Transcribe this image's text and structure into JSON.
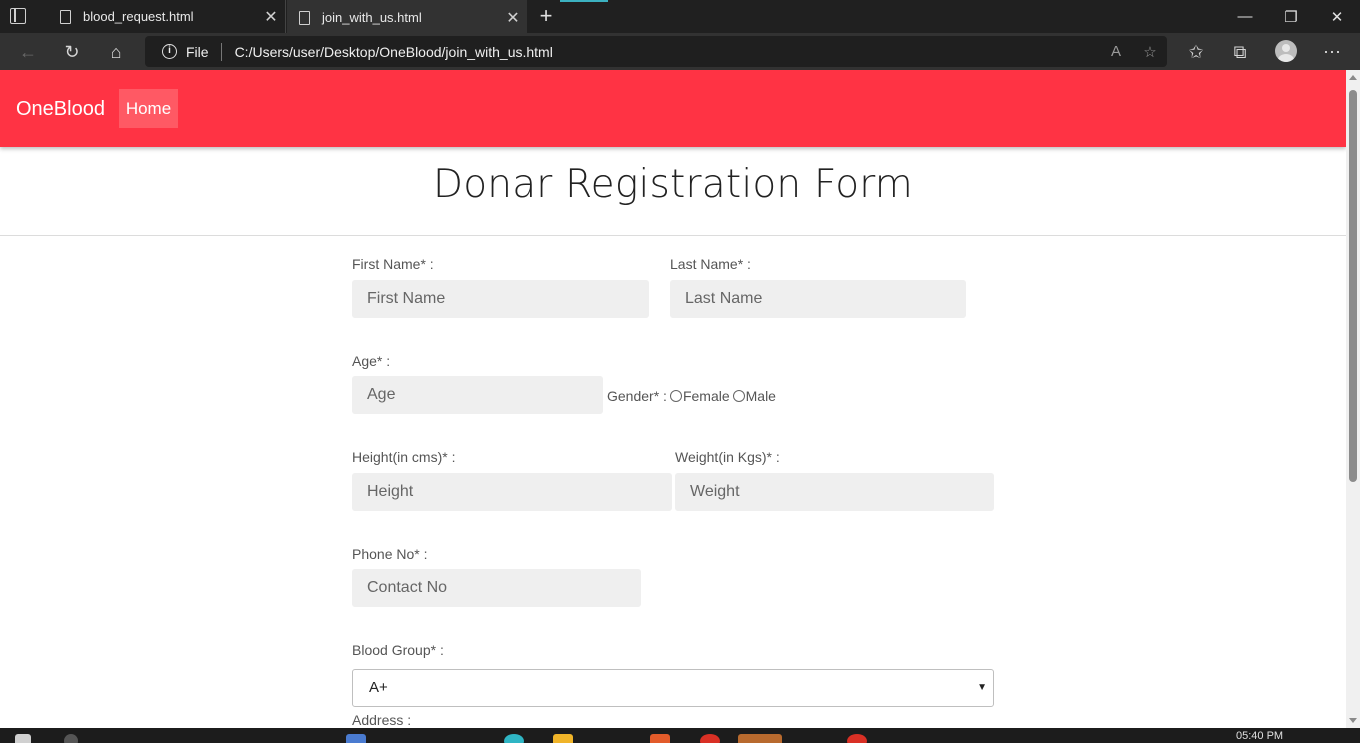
{
  "browser": {
    "tabs": [
      {
        "title": "blood_request.html",
        "close": "✕"
      },
      {
        "title": "join_with_us.html",
        "close": "✕"
      }
    ],
    "new_tab": "+",
    "window_controls": {
      "minimize": "—",
      "restore": "❐",
      "close": "✕"
    },
    "scheme": "File",
    "url": "C:/Users/user/Desktop/OneBlood/join_with_us.html",
    "icons": [
      "back-icon",
      "refresh-icon",
      "home-icon",
      "info-icon",
      "read-aloud-icon",
      "add-favorite-icon",
      "favorites-icon",
      "collections-icon",
      "profile-icon",
      "more-icon"
    ]
  },
  "navbar": {
    "brand": "OneBlood",
    "home": "Home",
    "color": "#ff3344"
  },
  "page": {
    "heading": "Donar Registration Form"
  },
  "form": {
    "first_name": {
      "label": "First Name* :",
      "placeholder": "First Name"
    },
    "last_name": {
      "label": "Last Name* :",
      "placeholder": "Last Name"
    },
    "age": {
      "label": "Age* :",
      "placeholder": "Age"
    },
    "gender": {
      "label": "Gender* :",
      "options": [
        "Female",
        "Male"
      ]
    },
    "height": {
      "label": "Height(in cms)* :",
      "placeholder": "Height"
    },
    "weight": {
      "label": "Weight(in Kgs)* :",
      "placeholder": "Weight"
    },
    "phone": {
      "label": "Phone No* :",
      "placeholder": "Contact No"
    },
    "blood_group": {
      "label": "Blood Group* :",
      "selected": "A+"
    },
    "address": {
      "label": "Address :"
    }
  },
  "taskbar": {
    "clock": "05:40 PM"
  }
}
